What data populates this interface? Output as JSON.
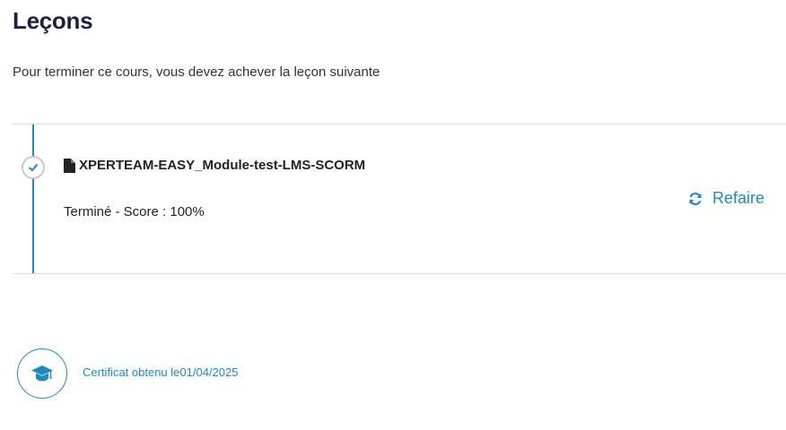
{
  "page": {
    "title": "Leçons",
    "subtitle": "Pour terminer ce cours, vous devez achever la leçon suivante"
  },
  "lesson": {
    "title": "XPERTEAM-EASY_Module-test-LMS-SCORM",
    "status": "Terminé - Score : 100%",
    "status_icon": "check-icon",
    "type_icon": "file-icon",
    "redo_label": "Refaire",
    "redo_icon": "refresh-icon"
  },
  "certificate": {
    "icon": "graduation-cap-icon",
    "text": "Certificat obtenu le01/04/2025"
  },
  "colors": {
    "accent": "#1f8ac0",
    "title": "#1c2340",
    "divider": "#dedede"
  }
}
